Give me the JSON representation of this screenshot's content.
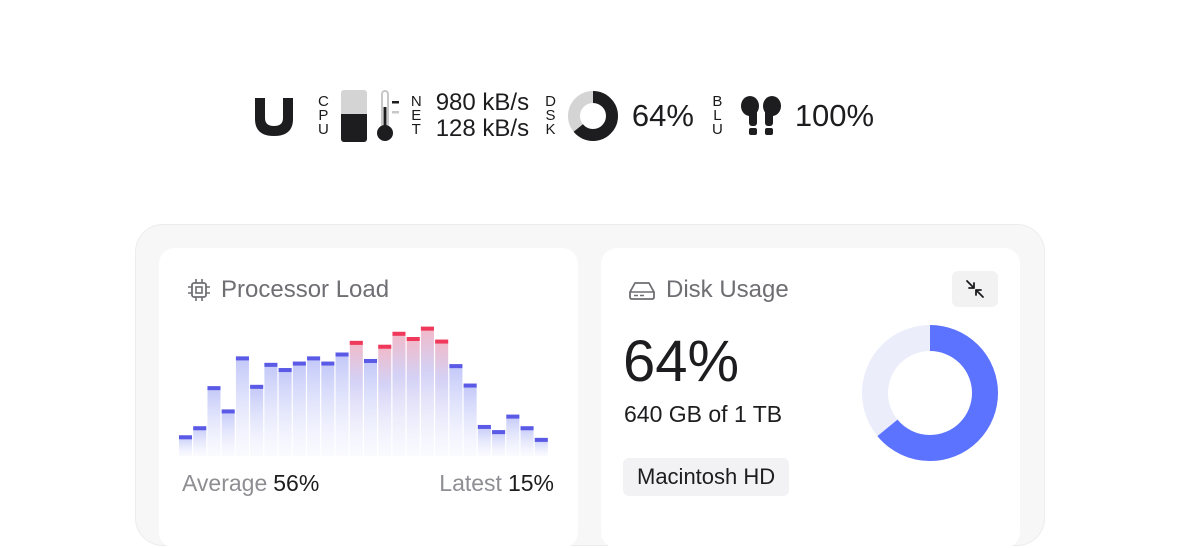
{
  "menubar": {
    "app_icon": "u-logo-icon",
    "cpu": {
      "label_letters": [
        "C",
        "P",
        "U"
      ],
      "load_fraction": 0.53
    },
    "temperature": {
      "icon": "thermometer-icon"
    },
    "network": {
      "label_letters": [
        "N",
        "E",
        "T"
      ],
      "download": "980 kB/s",
      "upload": "128 kB/s"
    },
    "disk": {
      "label_letters": [
        "D",
        "S",
        "K"
      ],
      "usage_fraction": 0.64,
      "percent_text": "64%"
    },
    "bluetooth": {
      "label_letters": [
        "B",
        "L",
        "U"
      ],
      "device_icon": "airpods-icon",
      "battery_text": "100%"
    }
  },
  "processor_card": {
    "title": "Processor Load",
    "icon": "chip-icon",
    "average_label": "Average",
    "average_value": "56%",
    "latest_label": "Latest",
    "latest_value": "15%"
  },
  "disk_card": {
    "title": "Disk Usage",
    "icon": "drive-icon",
    "collapse_icon": "collapse-arrows-icon",
    "percent": "64%",
    "capacity": "640 GB of 1 TB",
    "volume": "Macintosh HD",
    "usage_fraction": 0.64
  },
  "colors": {
    "accent_blue": "#5b73ff",
    "bar_blue": "#5a5ae6",
    "bar_red": "#f0385a",
    "track": "#ebedfb"
  },
  "chart_data": {
    "type": "bar",
    "ylim": [
      0,
      100
    ],
    "values": [
      16,
      23,
      54,
      36,
      77,
      55,
      72,
      68,
      73,
      77,
      73,
      80,
      89,
      75,
      86,
      96,
      92,
      100,
      90,
      71,
      56,
      24,
      20,
      32,
      23,
      14
    ],
    "high_threshold": 85
  }
}
